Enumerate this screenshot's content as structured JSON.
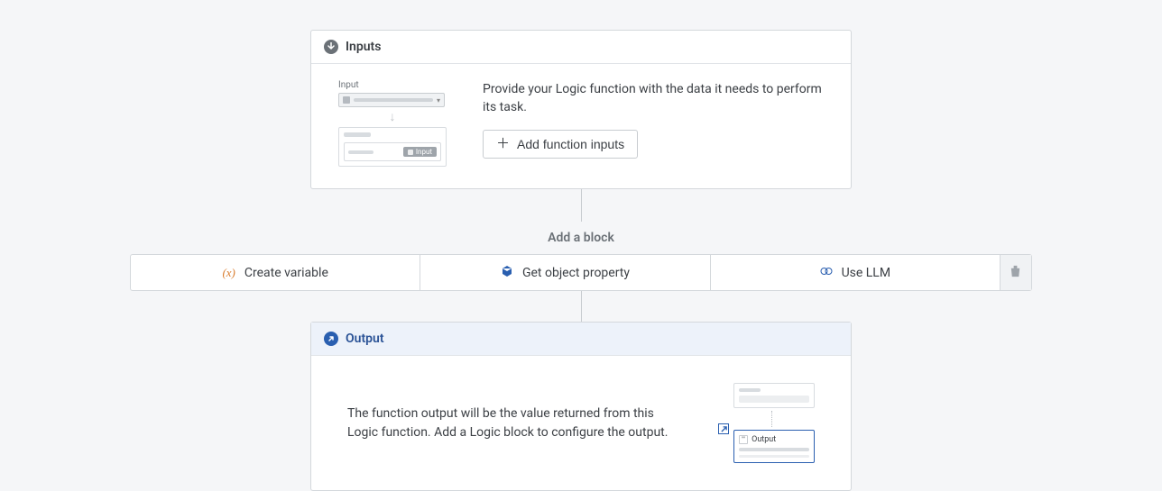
{
  "inputs": {
    "title": "Inputs",
    "illustration_label": "Input",
    "badge_label": "Input",
    "description": "Provide your Logic function with the data it needs to perform its task.",
    "add_button": "Add function inputs"
  },
  "add_block": {
    "label": "Add a block",
    "options": {
      "create_variable": "Create variable",
      "get_object_property": "Get object property",
      "use_llm": "Use LLM"
    }
  },
  "output": {
    "title": "Output",
    "description": "The function output will be the value returned from this Logic function. Add a Logic block to configure the output.",
    "illustration_label": "Output"
  }
}
